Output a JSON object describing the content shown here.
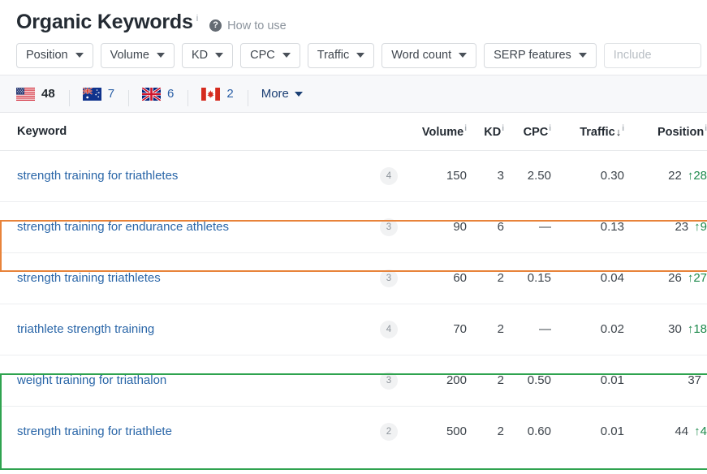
{
  "header": {
    "title": "Organic Keywords",
    "title_superscript": "i",
    "help_icon": "question-circle-icon",
    "help_label": "How to use"
  },
  "filters": {
    "buttons": [
      {
        "label": "Position"
      },
      {
        "label": "Volume"
      },
      {
        "label": "KD"
      },
      {
        "label": "CPC"
      },
      {
        "label": "Traffic"
      },
      {
        "label": "Word count"
      },
      {
        "label": "SERP features"
      }
    ],
    "include_input": {
      "value": "",
      "placeholder": "Include"
    }
  },
  "countries": {
    "items": [
      {
        "name": "United States",
        "flag": "us-flag-icon",
        "count": "48",
        "active": true
      },
      {
        "name": "Australia",
        "flag": "au-flag-icon",
        "count": "7",
        "active": false
      },
      {
        "name": "United Kingdom",
        "flag": "gb-flag-icon",
        "count": "6",
        "active": false
      },
      {
        "name": "Canada",
        "flag": "ca-flag-icon",
        "count": "2",
        "active": false
      }
    ],
    "more_label": "More"
  },
  "table": {
    "columns": {
      "keyword": "Keyword",
      "volume": "Volume",
      "kd": "KD",
      "cpc": "CPC",
      "traffic": "Traffic",
      "position": "Position",
      "sort_indicator": "↓",
      "info_superscript": "i"
    },
    "rows": [
      {
        "keyword": "strength training for triathletes",
        "word_count": "4",
        "volume": "150",
        "kd": "3",
        "cpc": "2.50",
        "traffic": "0.30",
        "position": "22",
        "position_delta": "↑28",
        "highlight": "none"
      },
      {
        "keyword": "strength training for endurance athletes",
        "word_count": "3",
        "volume": "90",
        "kd": "6",
        "cpc": "—",
        "traffic": "0.13",
        "position": "23",
        "position_delta": "↑9",
        "highlight": "orange"
      },
      {
        "keyword": "strength training triathletes",
        "word_count": "3",
        "volume": "60",
        "kd": "2",
        "cpc": "0.15",
        "traffic": "0.04",
        "position": "26",
        "position_delta": "↑27",
        "highlight": "none"
      },
      {
        "keyword": "triathlete strength training",
        "word_count": "4",
        "volume": "70",
        "kd": "2",
        "cpc": "—",
        "traffic": "0.02",
        "position": "30",
        "position_delta": "↑18",
        "highlight": "none"
      },
      {
        "keyword": "weight training for triathalon",
        "word_count": "3",
        "volume": "200",
        "kd": "2",
        "cpc": "0.50",
        "traffic": "0.01",
        "position": "37",
        "position_delta": "",
        "highlight": "green"
      },
      {
        "keyword": "strength training for triathlete",
        "word_count": "2",
        "volume": "500",
        "kd": "2",
        "cpc": "0.60",
        "traffic": "0.01",
        "position": "44",
        "position_delta": "↑4",
        "highlight": "green"
      }
    ]
  },
  "colors": {
    "highlight_orange": "#e8833a",
    "highlight_green": "#2fa34f",
    "link_blue": "#2a66a8",
    "delta_green": "#1f8a4d"
  }
}
